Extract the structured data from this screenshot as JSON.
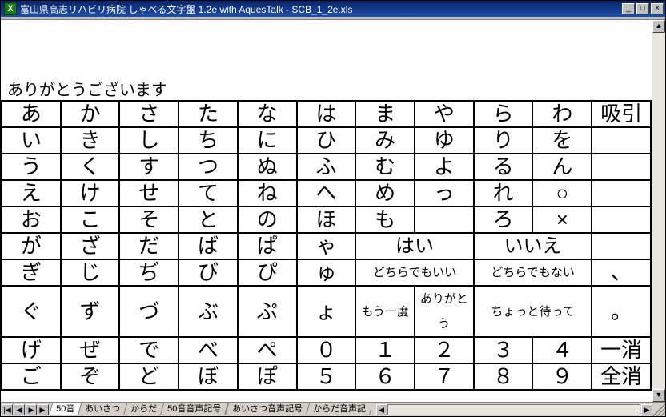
{
  "window": {
    "title": "富山県高志リハビリ病院   しゃべる文字盤   1.2e   with AquesTalk - SCB_1_2e.xls",
    "minimize": "_",
    "maximize": "□",
    "close": "×"
  },
  "display": {
    "text": "ありがとうございます"
  },
  "grid": {
    "rows": [
      [
        "あ",
        "か",
        "さ",
        "た",
        "な",
        "は",
        "ま",
        "や",
        "ら",
        "わ",
        "吸引"
      ],
      [
        "い",
        "き",
        "し",
        "ち",
        "に",
        "ひ",
        "み",
        "ゆ",
        "り",
        "を",
        ""
      ],
      [
        "う",
        "く",
        "す",
        "つ",
        "ぬ",
        "ふ",
        "む",
        "よ",
        "る",
        "ん",
        ""
      ],
      [
        "え",
        "け",
        "せ",
        "て",
        "ね",
        "へ",
        "め",
        "っ",
        "れ",
        "○",
        ""
      ],
      [
        "お",
        "こ",
        "そ",
        "と",
        "の",
        "ほ",
        "も",
        "",
        "ろ",
        "×",
        ""
      ]
    ],
    "row6": {
      "c0": "が",
      "c1": "ざ",
      "c2": "だ",
      "c3": "ば",
      "c4": "ぱ",
      "c5": "ゃ",
      "span1": "はい",
      "span2": "いいえ",
      "c10": ""
    },
    "row7": {
      "c0": "ぎ",
      "c1": "じ",
      "c2": "ぢ",
      "c3": "び",
      "c4": "ぴ",
      "c5": "ゅ",
      "span1": "どちらでもいい",
      "span2": "どちらでもない",
      "c10": "、"
    },
    "row8": {
      "c0": "ぐ",
      "c1": "ず",
      "c2": "づ",
      "c3": "ぶ",
      "c4": "ぷ",
      "c5": "ょ",
      "c6": "もう一度",
      "c7": "ありがとう",
      "span2": "ちょっと待って",
      "c10": "。"
    },
    "row9": [
      "げ",
      "ぜ",
      "で",
      "べ",
      "ぺ",
      "０",
      "１",
      "２",
      "３",
      "４",
      "一消"
    ],
    "row10": [
      "ご",
      "ぞ",
      "ど",
      "ぼ",
      "ぽ",
      "５",
      "６",
      "７",
      "８",
      "９",
      "全消"
    ]
  },
  "sheets": {
    "active": "50音",
    "tabs": [
      "50音",
      "あいさつ",
      "からだ",
      "50音音声記号",
      "あいさつ音声記号",
      "からだ音声記"
    ]
  },
  "nav": {
    "first": "|◀",
    "prev": "◀",
    "next": "▶",
    "last": "▶|"
  },
  "scroll": {
    "up": "▲",
    "down": "▼",
    "left": "◀",
    "right": "▶"
  }
}
